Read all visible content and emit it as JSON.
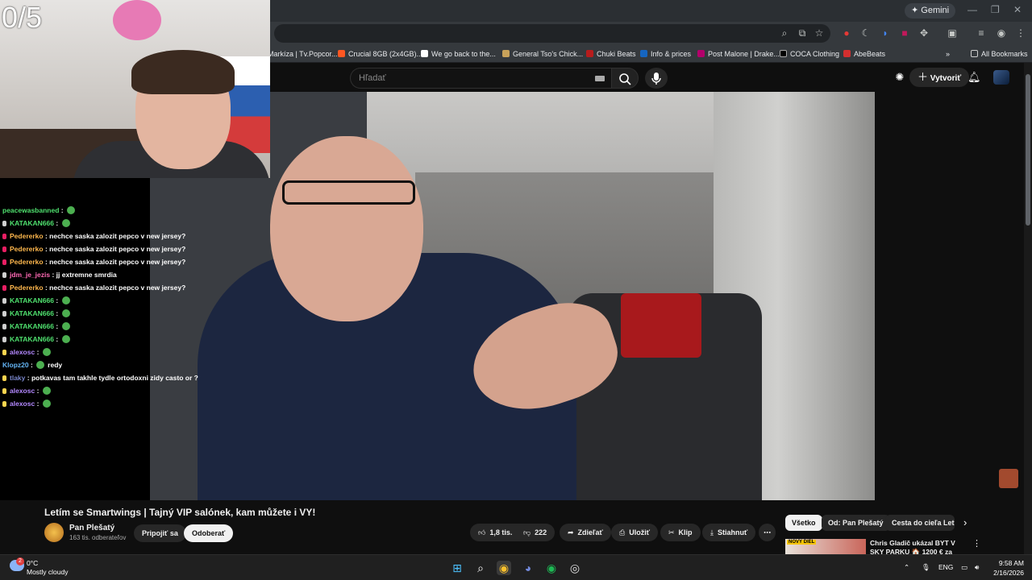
{
  "stream_overlay": {
    "counter": "0/5"
  },
  "browser": {
    "gemini_label": "Gemini",
    "bookmarks": [
      {
        "label": "Markíza | Tv.Popcor...",
        "color": "#e53935"
      },
      {
        "label": "Crucial 8GB (2x4GB)...",
        "color": "#ff5722"
      },
      {
        "label": "We go back to the...",
        "color": "#ffffff"
      },
      {
        "label": "General Tso's Chick...",
        "color": "#c8a25a"
      },
      {
        "label": "Chuki Beats",
        "color": "#b71c1c"
      },
      {
        "label": "Info & prices",
        "color": "#1565c0"
      },
      {
        "label": "Post Malone | Drake...",
        "color": "#b3006b"
      },
      {
        "label": "COCA Clothing",
        "color": "#000000"
      },
      {
        "label": "AbeBeats",
        "color": "#d32f2f"
      }
    ],
    "all_bookmarks": "All Bookmarks"
  },
  "youtube": {
    "search_placeholder": "Hľadať",
    "create_label": "Vytvoriť",
    "video": {
      "title": "Letím se Smartwings | Tajný VIP salónek, kam můžete i VY!",
      "channel": "Pan Plešatý",
      "subscribers": "163 tis. odberateľov",
      "join_label": "Pripojiť sa",
      "subscribe_label": "Odoberať",
      "likes": "1,8 tis.",
      "dislikes": "222",
      "share_label": "Zdieľať",
      "save_label": "Uložiť",
      "clip_label": "Klip",
      "download_label": "Stiahnuť",
      "more_label": "⋯"
    },
    "chips": [
      "Všetko",
      "Od: Pan Plešatý",
      "Cesta do cieľa Letisk"
    ],
    "recommendation": {
      "tag": "NOVÝ DIEL",
      "title": "Chris Gladič ukázal BYT V SKY PARKU 🏠 1200 € za NAJOMZ"
    }
  },
  "chat": [
    {
      "user": "peacewasbanned",
      "color": "#4fe06e",
      "badge": "",
      "text": "",
      "emote": true
    },
    {
      "user": "KATAKAN666",
      "color": "#4fe06e",
      "badge": "#cfcfcf",
      "text": "",
      "emote": true
    },
    {
      "user": "Pedererko",
      "color": "#ffb74d",
      "badge": "#e91e63",
      "text": "nechce saska zalozit pepco v new jersey?",
      "emote": false
    },
    {
      "user": "Pedererko",
      "color": "#ffb74d",
      "badge": "#e91e63",
      "text": "nechce saska zalozit pepco v new jersey?",
      "emote": false
    },
    {
      "user": "Pedererko",
      "color": "#ffb74d",
      "badge": "#e91e63",
      "text": "nechce saska zalozit pepco v new jersey?",
      "emote": false
    },
    {
      "user": "jdm_je_jezis",
      "color": "#ff69b4",
      "badge": "#cfcfcf",
      "text": "jj extremne smrdia",
      "emote": false
    },
    {
      "user": "Pedererko",
      "color": "#ffb74d",
      "badge": "#e91e63",
      "text": "nechce saska zalozit pepco v new jersey?",
      "emote": false
    },
    {
      "user": "KATAKAN666",
      "color": "#4fe06e",
      "badge": "#cfcfcf",
      "text": "",
      "emote": true
    },
    {
      "user": "KATAKAN666",
      "color": "#4fe06e",
      "badge": "#cfcfcf",
      "text": "",
      "emote": true
    },
    {
      "user": "KATAKAN666",
      "color": "#4fe06e",
      "badge": "#cfcfcf",
      "text": "",
      "emote": true
    },
    {
      "user": "KATAKAN666",
      "color": "#4fe06e",
      "badge": "#cfcfcf",
      "text": "",
      "emote": true
    },
    {
      "user": "alexosc",
      "color": "#b388ff",
      "badge": "#ffd54f",
      "text": "",
      "emote": true
    },
    {
      "user": "Klopz20",
      "color": "#64b5f6",
      "badge": "",
      "text": "redy",
      "emote": true
    },
    {
      "user": "tlaky",
      "color": "#7986cb",
      "badge": "#ffd54f",
      "text": "potkavas tam takhle tydle ortodoxni zidy casto or ?",
      "emote": false
    },
    {
      "user": "alexosc",
      "color": "#b388ff",
      "badge": "#ffd54f",
      "text": "",
      "emote": true
    },
    {
      "user": "alexosc",
      "color": "#b388ff",
      "badge": "#ffd54f",
      "text": "",
      "emote": true
    }
  ],
  "taskbar": {
    "weather_badge": "2",
    "temperature": "0°C",
    "condition": "Mostly cloudy",
    "language": "ENG",
    "time": "9:58 AM",
    "date": "2/16/2026"
  }
}
